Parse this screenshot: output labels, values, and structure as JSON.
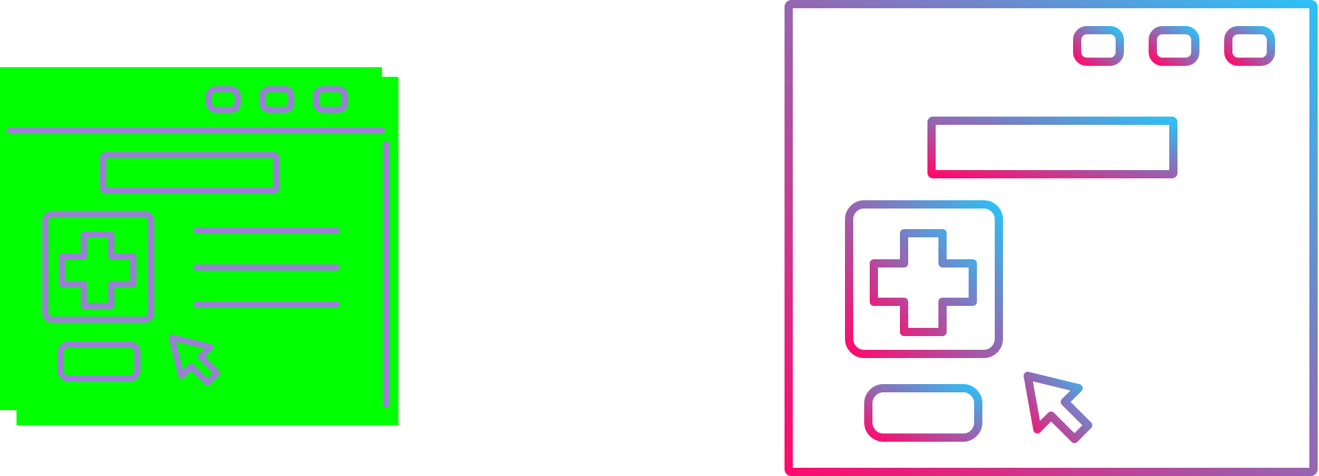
{
  "icons": [
    {
      "id": "medical-web-page-glyph",
      "style": "flat-offset",
      "fill_color": "#00ff00",
      "stroke_color": "#9b7fd6"
    },
    {
      "id": "medical-web-page-outline",
      "style": "gradient-line",
      "gradient_start": "#ff0a6c",
      "gradient_end": "#2ec0f5"
    }
  ]
}
